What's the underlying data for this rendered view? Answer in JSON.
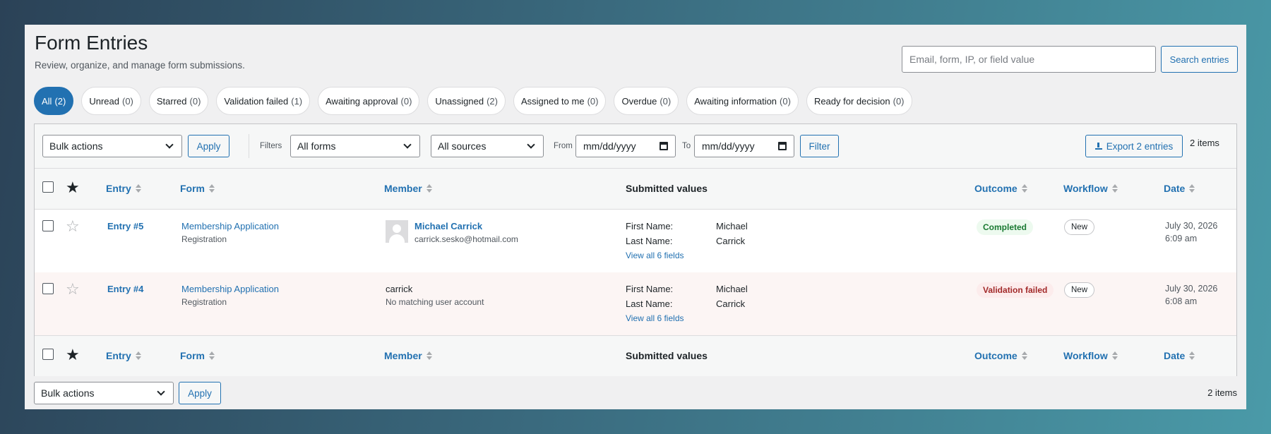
{
  "header": {
    "title": "Form Entries",
    "subtitle": "Review, organize, and manage form submissions.",
    "search_placeholder": "Email, form, IP, or field value",
    "search_button": "Search entries"
  },
  "tabs": [
    {
      "label": "All",
      "count": "(2)"
    },
    {
      "label": "Unread",
      "count": "(0)"
    },
    {
      "label": "Starred",
      "count": "(0)"
    },
    {
      "label": "Validation failed",
      "count": "(1)"
    },
    {
      "label": "Awaiting approval",
      "count": "(0)"
    },
    {
      "label": "Unassigned",
      "count": "(2)"
    },
    {
      "label": "Assigned to me",
      "count": "(0)"
    },
    {
      "label": "Overdue",
      "count": "(0)"
    },
    {
      "label": "Awaiting information",
      "count": "(0)"
    },
    {
      "label": "Ready for decision",
      "count": "(0)"
    }
  ],
  "toolbar": {
    "bulk_actions": "Bulk actions",
    "apply": "Apply",
    "filters_label": "Filters",
    "forms_select": "All forms",
    "sources_select": "All sources",
    "from_label": "From",
    "to_label": "To",
    "date_placeholder": "mm/dd/yyyy",
    "filter_button": "Filter",
    "export_button": "Export 2 entries",
    "items_count": "2 items"
  },
  "columns": {
    "entry": "Entry",
    "form": "Form",
    "member": "Member",
    "submitted": "Submitted values",
    "outcome": "Outcome",
    "workflow": "Workflow",
    "date": "Date"
  },
  "rows": [
    {
      "entry": "Entry #5",
      "form": "Membership Application",
      "form_sub": "Registration",
      "member_name": "Michael Carrick",
      "member_email": "carrick.sesko@hotmail.com",
      "fields": [
        {
          "label": "First Name:",
          "value": "Michael"
        },
        {
          "label": "Last Name:",
          "value": "Carrick"
        }
      ],
      "view_all": "View all 6 fields",
      "outcome": "Completed",
      "workflow": "New",
      "date": "July 30, 2026",
      "time": "6:09 am"
    },
    {
      "entry": "Entry #4",
      "form": "Membership Application",
      "form_sub": "Registration",
      "member_name": "carrick",
      "member_email": "No matching user account",
      "fields": [
        {
          "label": "First Name:",
          "value": "Michael"
        },
        {
          "label": "Last Name:",
          "value": "Carrick"
        }
      ],
      "view_all": "View all 6 fields",
      "outcome": "Validation failed",
      "workflow": "New",
      "date": "July 30, 2026",
      "time": "6:08 am"
    }
  ],
  "bottom": {
    "bulk_actions": "Bulk actions",
    "apply": "Apply",
    "items_count": "2 items"
  }
}
